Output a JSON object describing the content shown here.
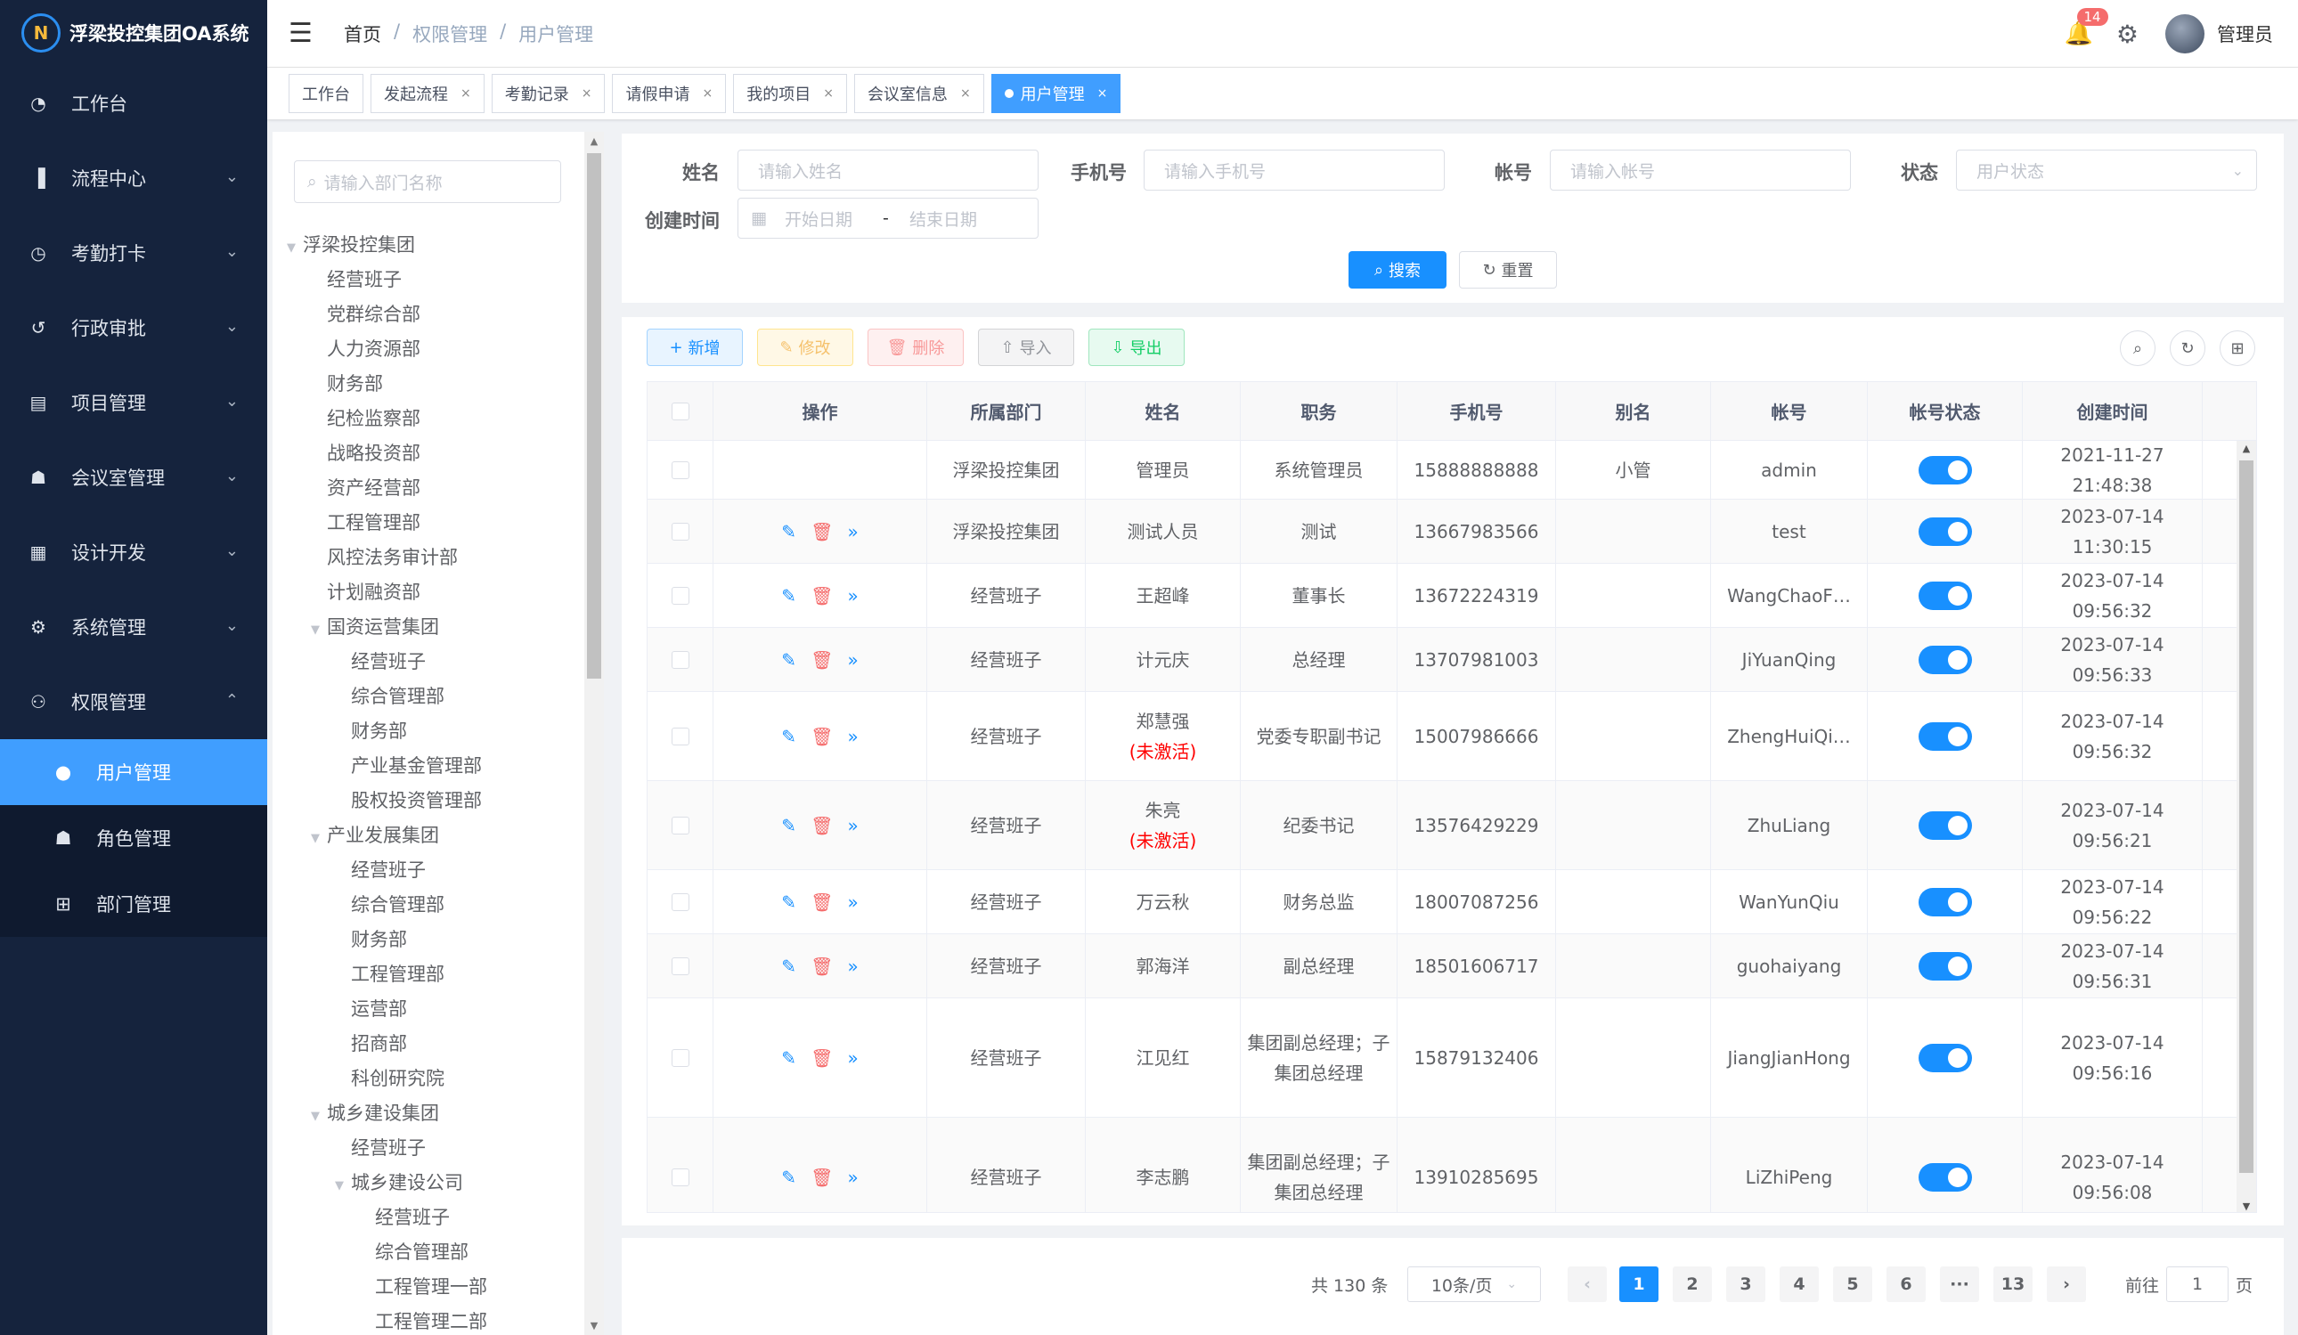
{
  "app": {
    "title": "浮梁投控集团OA系统",
    "logo_glyph": "N"
  },
  "sidebar": {
    "items": [
      {
        "label": "工作台",
        "icon": "dashboard-icon",
        "glyph": "◔",
        "chevron": ""
      },
      {
        "label": "流程中心",
        "icon": "bar-chart-icon",
        "glyph": "▐",
        "chevron": "⌄"
      },
      {
        "label": "考勤打卡",
        "icon": "clock-icon",
        "glyph": "◷",
        "chevron": "⌄"
      },
      {
        "label": "行政审批",
        "icon": "history-icon",
        "glyph": "↺",
        "chevron": "⌄"
      },
      {
        "label": "项目管理",
        "icon": "project-icon",
        "glyph": "▤",
        "chevron": "⌄"
      },
      {
        "label": "会议室管理",
        "icon": "group-icon",
        "glyph": "☗",
        "chevron": "⌄"
      },
      {
        "label": "设计开发",
        "icon": "document-icon",
        "glyph": "▦",
        "chevron": "⌄"
      },
      {
        "label": "系统管理",
        "icon": "gear-icon",
        "glyph": "⚙",
        "chevron": "⌄"
      },
      {
        "label": "权限管理",
        "icon": "user-icon",
        "glyph": "⚇",
        "chevron": "⌃"
      }
    ],
    "sub_items": [
      {
        "label": "用户管理",
        "icon": "user-icon",
        "glyph": "●"
      },
      {
        "label": "角色管理",
        "icon": "role-icon",
        "glyph": "☗"
      },
      {
        "label": "部门管理",
        "icon": "org-tree-icon",
        "glyph": "⊞"
      }
    ]
  },
  "header": {
    "breadcrumb": [
      "首页",
      "/",
      "权限管理",
      "/",
      "用户管理"
    ],
    "notification_count": "14",
    "username": "管理员"
  },
  "tabs": [
    {
      "label": "工作台",
      "closable": false,
      "active": false
    },
    {
      "label": "发起流程",
      "closable": true,
      "active": false
    },
    {
      "label": "考勤记录",
      "closable": true,
      "active": false
    },
    {
      "label": "请假申请",
      "closable": true,
      "active": false
    },
    {
      "label": "我的项目",
      "closable": true,
      "active": false
    },
    {
      "label": "会议室信息",
      "closable": true,
      "active": false
    },
    {
      "label": "用户管理",
      "closable": true,
      "active": true
    }
  ],
  "dept_tree": {
    "search_placeholder": "请输入部门名称",
    "nodes": [
      {
        "label": "浮梁投控集团",
        "level": 0,
        "expanded": true
      },
      {
        "label": "经营班子",
        "level": 1
      },
      {
        "label": "党群综合部",
        "level": 1
      },
      {
        "label": "人力资源部",
        "level": 1
      },
      {
        "label": "财务部",
        "level": 1
      },
      {
        "label": "纪检监察部",
        "level": 1
      },
      {
        "label": "战略投资部",
        "level": 1
      },
      {
        "label": "资产经营部",
        "level": 1
      },
      {
        "label": "工程管理部",
        "level": 1
      },
      {
        "label": "风控法务审计部",
        "level": 1
      },
      {
        "label": "计划融资部",
        "level": 1
      },
      {
        "label": "国资运营集团",
        "level": 1,
        "expanded": true
      },
      {
        "label": "经营班子",
        "level": 2
      },
      {
        "label": "综合管理部",
        "level": 2
      },
      {
        "label": "财务部",
        "level": 2
      },
      {
        "label": "产业基金管理部",
        "level": 2
      },
      {
        "label": "股权投资管理部",
        "level": 2
      },
      {
        "label": "产业发展集团",
        "level": 1,
        "expanded": true
      },
      {
        "label": "经营班子",
        "level": 2
      },
      {
        "label": "综合管理部",
        "level": 2
      },
      {
        "label": "财务部",
        "level": 2
      },
      {
        "label": "工程管理部",
        "level": 2
      },
      {
        "label": "运营部",
        "level": 2
      },
      {
        "label": "招商部",
        "level": 2
      },
      {
        "label": "科创研究院",
        "level": 2
      },
      {
        "label": "城乡建设集团",
        "level": 1,
        "expanded": true
      },
      {
        "label": "经营班子",
        "level": 2
      },
      {
        "label": "城乡建设公司",
        "level": 2,
        "expanded": true
      },
      {
        "label": "经营班子",
        "level": 3
      },
      {
        "label": "综合管理部",
        "level": 3
      },
      {
        "label": "工程管理一部",
        "level": 3
      },
      {
        "label": "工程管理二部",
        "level": 3
      }
    ]
  },
  "filters": {
    "name": {
      "label": "姓名",
      "placeholder": "请输入姓名"
    },
    "phone": {
      "label": "手机号",
      "placeholder": "请输入手机号"
    },
    "account": {
      "label": "帐号",
      "placeholder": "请输入帐号"
    },
    "status": {
      "label": "状态",
      "placeholder": "用户状态"
    },
    "created": {
      "label": "创建时间",
      "start_placeholder": "开始日期",
      "separator": "-",
      "end_placeholder": "结束日期"
    },
    "search_label": "搜索",
    "reset_label": "重置"
  },
  "toolbar": {
    "add_label": "新增",
    "edit_label": "修改",
    "delete_label": "删除",
    "import_label": "导入",
    "export_label": "导出"
  },
  "table": {
    "columns": [
      "操作",
      "所属部门",
      "姓名",
      "职务",
      "手机号",
      "别名",
      "帐号",
      "帐号状态",
      "创建时间"
    ],
    "rows": [
      {
        "dept": "浮梁投控集团",
        "name": "管理员",
        "inactive": "",
        "title": "系统管理员",
        "phone": "15888888888",
        "alias": "小管",
        "account": "admin",
        "enabled": true,
        "created": "2021-11-27 21:48:38",
        "ops": false
      },
      {
        "dept": "浮梁投控集团",
        "name": "测试人员",
        "inactive": "",
        "title": "测试",
        "phone": "13667983566",
        "alias": "",
        "account": "test",
        "enabled": true,
        "created": "2023-07-14 11:30:15",
        "ops": true
      },
      {
        "dept": "经营班子",
        "name": "王超峰",
        "inactive": "",
        "title": "董事长",
        "phone": "13672224319",
        "alias": "",
        "account": "WangChaoF…",
        "enabled": true,
        "created": "2023-07-14 09:56:32",
        "ops": true
      },
      {
        "dept": "经营班子",
        "name": "计元庆",
        "inactive": "",
        "title": "总经理",
        "phone": "13707981003",
        "alias": "",
        "account": "JiYuanQing",
        "enabled": true,
        "created": "2023-07-14 09:56:33",
        "ops": true
      },
      {
        "dept": "经营班子",
        "name": "郑慧强",
        "inactive": "(未激活)",
        "title": "党委专职副书记",
        "phone": "15007986666",
        "alias": "",
        "account": "ZhengHuiQi…",
        "enabled": true,
        "created": "2023-07-14 09:56:32",
        "ops": true
      },
      {
        "dept": "经营班子",
        "name": "朱亮",
        "inactive": "(未激活)",
        "title": "纪委书记",
        "phone": "13576429229",
        "alias": "",
        "account": "ZhuLiang",
        "enabled": true,
        "created": "2023-07-14 09:56:21",
        "ops": true
      },
      {
        "dept": "经营班子",
        "name": "万云秋",
        "inactive": "",
        "title": "财务总监",
        "phone": "18007087256",
        "alias": "",
        "account": "WanYunQiu",
        "enabled": true,
        "created": "2023-07-14 09:56:22",
        "ops": true
      },
      {
        "dept": "经营班子",
        "name": "郭海洋",
        "inactive": "",
        "title": "副总经理",
        "phone": "18501606717",
        "alias": "",
        "account": "guohaiyang",
        "enabled": true,
        "created": "2023-07-14 09:56:31",
        "ops": true
      },
      {
        "dept": "经营班子",
        "name": "江见红",
        "inactive": "",
        "title": "集团副总经理；子集团总经理",
        "phone": "15879132406",
        "alias": "",
        "account": "JiangJianHong",
        "enabled": true,
        "created": "2023-07-14 09:56:16",
        "ops": true
      },
      {
        "dept": "经营班子",
        "name": "李志鹏",
        "inactive": "",
        "title": "集团副总经理；子集团总经理",
        "phone": "13910285695",
        "alias": "",
        "account": "LiZhiPeng",
        "enabled": true,
        "created": "2023-07-14 09:56:08",
        "ops": true
      }
    ]
  },
  "pagination": {
    "total_text": "共 130 条",
    "page_size": "10条/页",
    "pages": [
      "1",
      "2",
      "3",
      "4",
      "5",
      "6",
      "···",
      "13"
    ],
    "current": "1",
    "goto_prefix": "前往",
    "goto_value": "1",
    "goto_suffix": "页"
  },
  "colors": {
    "primary": "#1890ff",
    "sidebar_bg": "#15233d",
    "active_menu": "#409eff",
    "danger": "#f56c6c"
  }
}
